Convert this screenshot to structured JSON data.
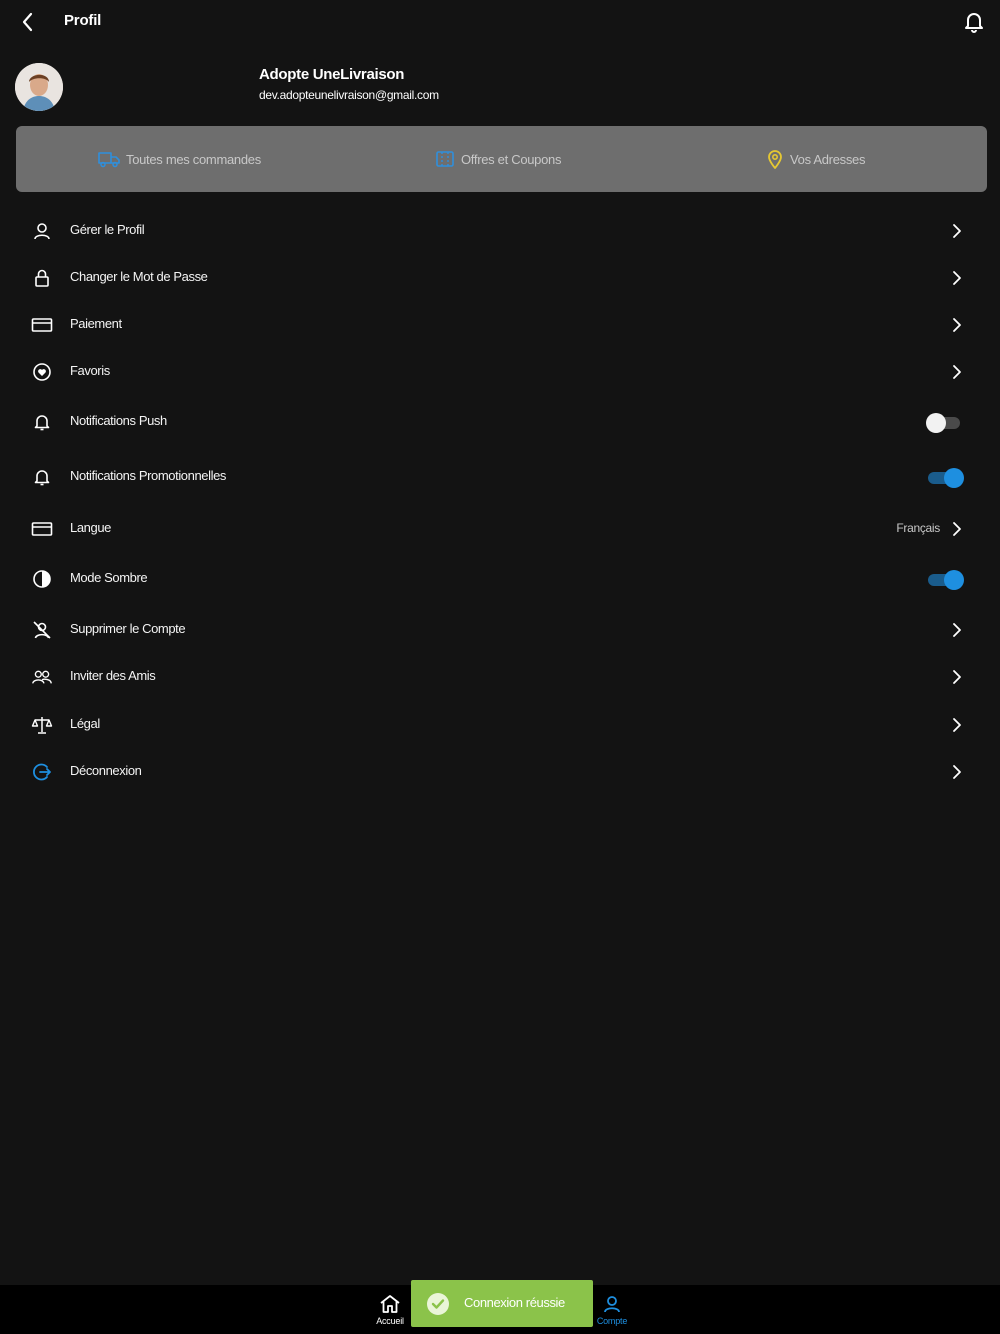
{
  "header": {
    "title": "Profil"
  },
  "user": {
    "name": "Adopte UneLivraison",
    "email": "dev.adopteunelivraison@gmail.com"
  },
  "quick_actions": [
    {
      "label": "Toutes mes commandes",
      "icon": "delivery-truck-icon"
    },
    {
      "label": "Offres et Coupons",
      "icon": "coupon-icon"
    },
    {
      "label": "Vos Adresses",
      "icon": "location-pin-icon"
    }
  ],
  "menu": {
    "manage_profile": "Gérer le Profil",
    "change_password": "Changer le Mot de Passe",
    "payment": "Paiement",
    "favorites": "Favoris",
    "push_notifications": "Notifications Push",
    "promo_notifications": "Notifications Promotionnelles",
    "language": "Langue",
    "language_value": "Français",
    "dark_mode": "Mode Sombre",
    "delete_account": "Supprimer le Compte",
    "invite_friends": "Inviter des Amis",
    "legal": "Légal",
    "logout": "Déconnexion"
  },
  "toggles": {
    "push_notifications": false,
    "promo_notifications": true,
    "dark_mode": true
  },
  "bottom_nav": {
    "home": "Accueil",
    "account": "Compte"
  },
  "toast": {
    "message": "Connexion réussie"
  },
  "colors": {
    "background": "#131313",
    "accent": "#1e8fe0",
    "quick_bar": "#6e6e6e",
    "toast": "#8bc34a",
    "pin": "#e6c832"
  }
}
